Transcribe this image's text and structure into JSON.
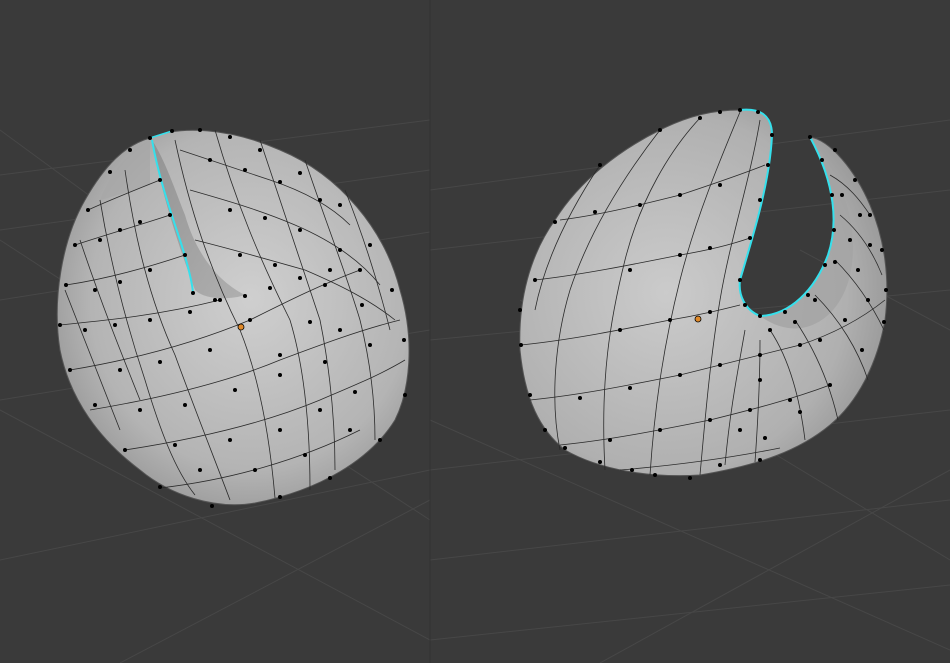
{
  "app": {
    "name": "",
    "mode": ""
  },
  "viewports": [
    {
      "id": "left",
      "object": "",
      "selected_edge": "seam-loop",
      "origin_marker": "object-origin"
    },
    {
      "id": "right",
      "object": "",
      "selected_edge": "seam-loop",
      "origin_marker": "object-origin"
    }
  ],
  "colors": {
    "background": "#3a3a3a",
    "grid": "#4a4a4a",
    "mesh_fill": "#bdbdbd",
    "wire": "#1e1e1e",
    "vertex": "#000000",
    "selected_edge": "#35e0ec",
    "origin": "#e08a2a"
  }
}
